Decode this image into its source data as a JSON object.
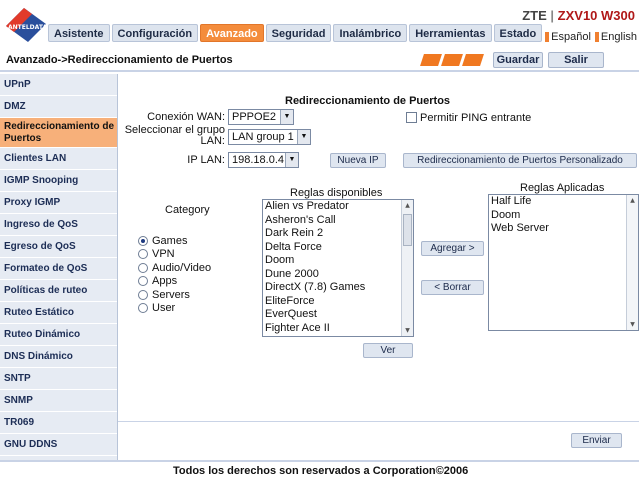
{
  "header": {
    "logo_text": "ANTELDATA",
    "brand_zte": "ZTE",
    "brand_sep": " | ",
    "brand_model": "ZXV10 W300",
    "tabs": [
      {
        "label": "Asistente"
      },
      {
        "label": "Configuración"
      },
      {
        "label": "Avanzado"
      },
      {
        "label": "Seguridad"
      },
      {
        "label": "Inalámbrico"
      },
      {
        "label": "Herramientas"
      },
      {
        "label": "Estado"
      }
    ],
    "active_tab": "Avanzado",
    "languages": [
      {
        "label": "Español"
      },
      {
        "label": "English"
      }
    ],
    "accent_color": "#f48c3c"
  },
  "breadcrumb": "Avanzado->Redireccionamiento de Puertos",
  "toolbar": {
    "save_label": "Guardar",
    "exit_label": "Salir"
  },
  "sidebar": {
    "items": [
      {
        "label": "UPnP"
      },
      {
        "label": "DMZ"
      },
      {
        "label": "Redireccionamiento de Puertos"
      },
      {
        "label": "Clientes LAN"
      },
      {
        "label": "IGMP Snooping"
      },
      {
        "label": "Proxy IGMP"
      },
      {
        "label": "Ingreso de QoS"
      },
      {
        "label": "Egreso de QoS"
      },
      {
        "label": "Formateo de QoS"
      },
      {
        "label": "Políticas de ruteo"
      },
      {
        "label": "Ruteo Estático"
      },
      {
        "label": "Ruteo Dinámico"
      },
      {
        "label": "DNS Dinámico"
      },
      {
        "label": "SNTP"
      },
      {
        "label": "SNMP"
      },
      {
        "label": "TR069"
      },
      {
        "label": "GNU DDNS"
      }
    ],
    "active_index": 2
  },
  "main": {
    "title": "Redireccionamiento de Puertos",
    "wan_label": "Conexión WAN:",
    "wan_value": "PPPOE2",
    "ping_label": "Permitir PING entrante",
    "ping_checked": false,
    "group_label_1": "Seleccionar el grupo",
    "group_label_2": "LAN:",
    "group_value": "LAN group 1",
    "ip_label": "IP LAN:",
    "ip_value": "198.18.0.4",
    "new_ip_button": "Nueva IP",
    "custom_button": "Redireccionamiento de Puertos Personalizado",
    "category_label": "Category",
    "categories": [
      {
        "label": "Games",
        "selected": true
      },
      {
        "label": "VPN",
        "selected": false
      },
      {
        "label": "Audio/Video",
        "selected": false
      },
      {
        "label": "Apps",
        "selected": false
      },
      {
        "label": "Servers",
        "selected": false
      },
      {
        "label": "User",
        "selected": false
      }
    ],
    "available_label": "Reglas disponibles",
    "available_rules": [
      "Alien vs Predator",
      "Asheron's Call",
      "Dark Rein 2",
      "Delta Force",
      "Doom",
      "Dune 2000",
      "DirectX (7.8) Games",
      "EliteForce",
      "EverQuest",
      "Fighter Ace II"
    ],
    "add_button": "Agregar >",
    "remove_button": "< Borrar",
    "applied_label": "Reglas Aplicadas",
    "applied_rules": [
      "Half Life",
      "Doom",
      "Web Server"
    ],
    "view_button": "Ver",
    "send_button": "Enviar"
  },
  "footer": "Todos los derechos son reservados a Corporation©2006"
}
